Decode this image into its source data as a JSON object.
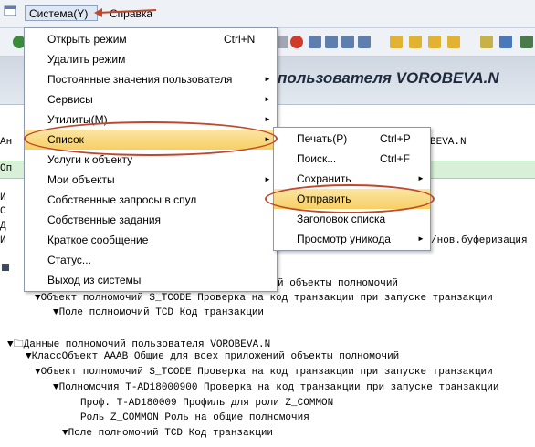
{
  "menubar": {
    "system_label": "Система(Y)",
    "help_label": "Справка"
  },
  "title": "пользователя VOROBEVA.N",
  "background_lines": {
    "row_a": "Ан",
    "row_a_right": "BEVA.N",
    "row_op": "Оп",
    "side_letters": [
      "И",
      "С",
      "Д",
      "И"
    ],
    "buffer_text": "/нов.буферизация",
    "tree1_line1": "й объекты полномочий",
    "tree1_line2": "▼Объект полномочий S_TCODE    Проверка на код транзакции при запуске транзакции",
    "tree1_line3": "▼Поле полномочий TCD Код транзакции",
    "tree2_line1": "▼🗀Данные полномочий пользователя VOROBEVA.N",
    "tree2_line2": "▼КлассОбъект AAAB       Общие для всех приложений объекты полномочий",
    "tree2_line3": "▼Объект полномочий S_TCODE    Проверка на код транзакции при запуске транзакции",
    "tree2_line4": "▼Полномочия T-AD18000900 Проверка на код транзакции при запуске транзакции",
    "tree2_line5": "Проф. T-AD180009   Профиль для роли Z_COMMON",
    "tree2_line6": "Роль Z_COMMON Роль на общие полномочия",
    "tree2_line7": "▼Поле полномочий TCD Код транзакции"
  },
  "system_menu": {
    "items": [
      {
        "label": "Открыть режим",
        "shortcut": "Ctrl+N"
      },
      {
        "label": "Удалить режим"
      },
      {
        "label": "Постоянные значения пользователя",
        "submenu": true
      },
      {
        "label": "Сервисы",
        "submenu": true
      },
      {
        "label": "Утилиты(М)",
        "submenu": true
      },
      {
        "label": "Список",
        "submenu": true,
        "highlighted": true
      },
      {
        "label": "Услуги к объекту"
      },
      {
        "label": "Мои объекты",
        "submenu": true
      },
      {
        "label": "Собственные запросы в спул"
      },
      {
        "label": "Собственные задания"
      },
      {
        "label": "Краткое сообщение"
      },
      {
        "label": "Статус..."
      },
      {
        "label": "Выход из системы"
      }
    ]
  },
  "list_submenu": {
    "items": [
      {
        "label": "Печать(Р)",
        "shortcut": "Ctrl+P"
      },
      {
        "label": "Поиск...",
        "shortcut": "Ctrl+F"
      },
      {
        "label": "Сохранить",
        "submenu": true
      },
      {
        "label": "Отправить",
        "highlighted": true
      },
      {
        "label": "Заголовок списка"
      },
      {
        "label": "Просмотр уникода",
        "submenu": true
      }
    ]
  },
  "arrow_glyph": "►",
  "colors": {
    "highlight": "#f7cf66",
    "annotation": "#c0472a",
    "menubar": "#eef1f6"
  }
}
